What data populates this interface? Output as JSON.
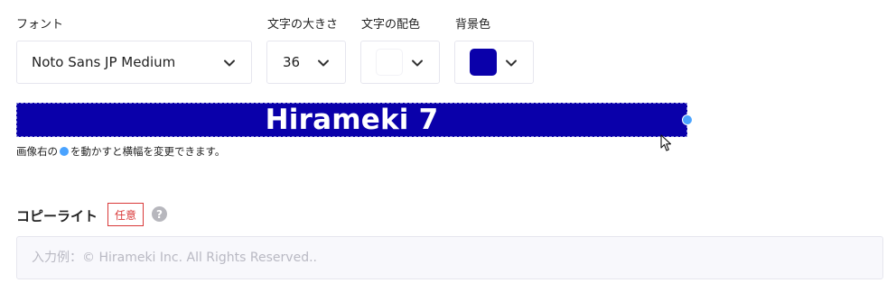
{
  "labels": {
    "font": "フォント",
    "font_size": "文字の大きさ",
    "text_color": "文字の配色",
    "background_color": "背景色"
  },
  "controls": {
    "font_value": "Noto Sans JP Medium",
    "size_value": "36",
    "text_color_value": "#ffffff",
    "background_color_value": "#0a00aa"
  },
  "preview": {
    "text": "Hirameki 7",
    "handle_color": "#4aa3ff"
  },
  "hint": {
    "before": "画像右の",
    "after": "を動かすと横幅を変更できます。"
  },
  "copyright": {
    "title": "コピーライト",
    "badge": "任意",
    "help_icon": "?",
    "placeholder": "入力例：© Hirameki Inc. All Rights Reserved.."
  },
  "colors": {
    "required_red": "#d93838",
    "handle_blue": "#4aa3ff"
  },
  "icons": {
    "chevron": "chevron-down-icon",
    "help": "question-circle-icon",
    "cursor": "mouse-pointer-icon"
  }
}
